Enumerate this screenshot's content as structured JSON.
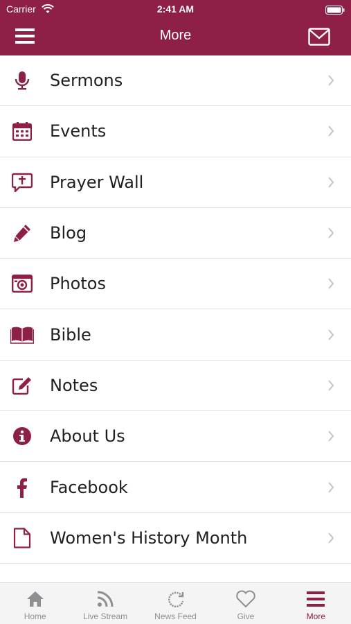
{
  "status_bar": {
    "carrier": "Carrier",
    "time": "2:41 AM"
  },
  "nav": {
    "title": "More",
    "menu_icon": "hamburger-icon",
    "mail_icon": "envelope-icon"
  },
  "colors": {
    "brand": "#8e1f47",
    "tab_inactive": "#8e8e93",
    "text": "#1f1f1f"
  },
  "menu_items": [
    {
      "label": "Sermons",
      "icon": "microphone-icon"
    },
    {
      "label": "Events",
      "icon": "calendar-icon"
    },
    {
      "label": "Prayer Wall",
      "icon": "prayer-bubble-icon"
    },
    {
      "label": "Blog",
      "icon": "pencil-icon"
    },
    {
      "label": "Photos",
      "icon": "camera-icon"
    },
    {
      "label": "Bible",
      "icon": "open-book-icon"
    },
    {
      "label": "Notes",
      "icon": "edit-note-icon"
    },
    {
      "label": "About Us",
      "icon": "info-icon"
    },
    {
      "label": "Facebook",
      "icon": "facebook-icon"
    },
    {
      "label": "Women's History Month",
      "icon": "document-icon"
    }
  ],
  "tabs": [
    {
      "label": "Home",
      "icon": "home-icon"
    },
    {
      "label": "Live Stream",
      "icon": "rss-icon"
    },
    {
      "label": "News Feed",
      "icon": "refresh-icon"
    },
    {
      "label": "Give",
      "icon": "heart-icon"
    },
    {
      "label": "More",
      "icon": "hamburger-icon",
      "active": true
    }
  ]
}
